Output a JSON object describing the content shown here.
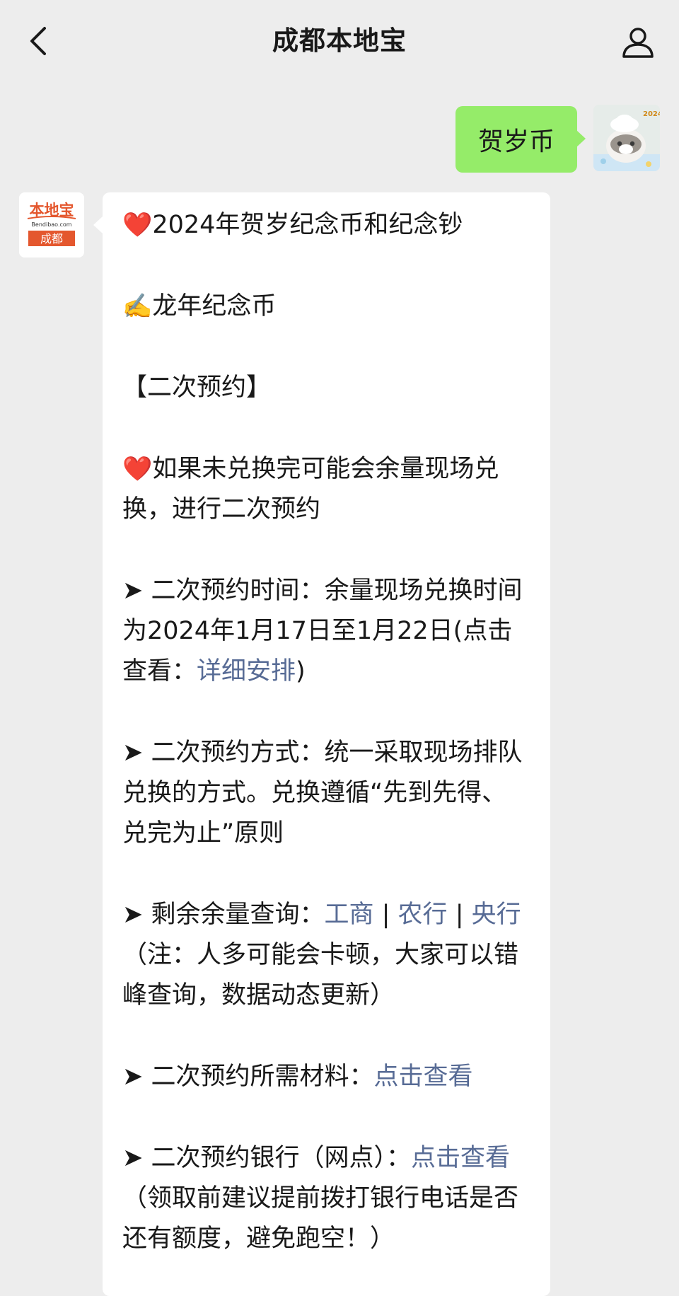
{
  "header": {
    "title": "成都本地宝",
    "back_icon": "chevron-left-icon",
    "profile_icon": "person-icon"
  },
  "outgoing": {
    "text": "贺岁币",
    "avatar_badge": "2024"
  },
  "bot_avatar": {
    "logo_top": "本地宝",
    "logo_url": "Bendibao.com",
    "logo_city": "成都"
  },
  "message": {
    "heart": "❤️",
    "writing": "✍️",
    "arrow": "➤",
    "line1": "2024年贺岁纪念币和纪念钞",
    "line2": "龙年纪念币",
    "line3": "【二次预约】",
    "line4": "如果未兑换完可能会余量现场兑换，进行二次预约",
    "time_text": "二次预约时间：余量现场兑换时间为2024年1月17日至1月22日(点击查看：",
    "time_link": "详细安排",
    "time_close": ")",
    "method_text": "二次预约方式：统一采取现场排队兑换的方式。兑换遵循“先到先得、兑完为止”原则",
    "query_text": "剩余余量查询：",
    "query_link1": "工商",
    "query_sep1": " | ",
    "query_link2": "农行",
    "query_sep2": " | ",
    "query_link3": "央行",
    "query_note": "（注：人多可能会卡顿，大家可以错峰查询，数据动态更新）",
    "material_text": "二次预约所需材料：",
    "material_link": "点击查看",
    "bank_text": "二次预约银行（网点）：",
    "bank_link": "点击查看",
    "bank_note": "（领取前建议提前拨打银行电话是否还有额度，避免跑空！）"
  },
  "colors": {
    "background": "#ededed",
    "outgoing_bubble": "#95ec69",
    "link": "#576b95",
    "logo_orange": "#e4572e"
  }
}
